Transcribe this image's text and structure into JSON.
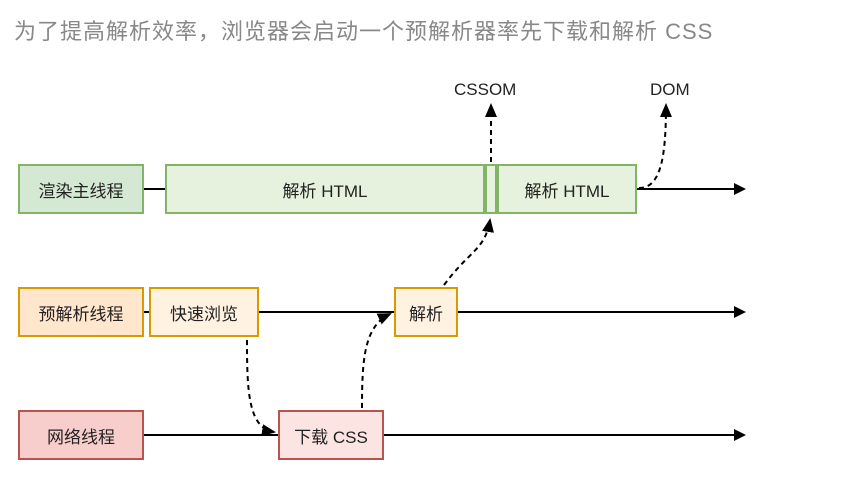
{
  "title": "为了提高解析效率，浏览器会启动一个预解析器率先下载和解析  CSS",
  "labels": {
    "cssom": "CSSOM",
    "dom": "DOM"
  },
  "threads": {
    "render": {
      "name": "渲染主线程",
      "tasks": {
        "parseHtml1": "解析 HTML",
        "parseHtml2": "解析 HTML"
      }
    },
    "preparse": {
      "name": "预解析线程",
      "tasks": {
        "quickScan": "快速浏览",
        "parse": "解析"
      }
    },
    "network": {
      "name": "网络线程",
      "tasks": {
        "downloadCss": "下载 CSS"
      }
    }
  }
}
